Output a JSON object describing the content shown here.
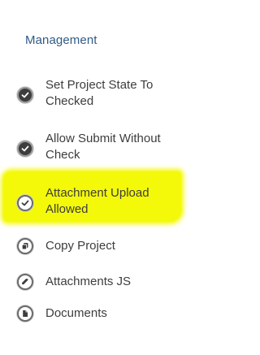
{
  "panel": {
    "section_title": "Management",
    "items": [
      {
        "label": "Set Project State To\nChecked",
        "icon": "checkmark-icon",
        "highlighted": false
      },
      {
        "label": "Allow Submit Without\nCheck",
        "icon": "checkmark-icon",
        "highlighted": false
      },
      {
        "label": "Attachment Upload\nAllowed",
        "icon": "checkmark-icon",
        "highlighted": true
      },
      {
        "label": "Copy Project",
        "icon": "copy-icon",
        "highlighted": false
      },
      {
        "label": "Attachments JS",
        "icon": "paperclip-icon",
        "highlighted": false
      },
      {
        "label": "Documents",
        "icon": "document-icon",
        "highlighted": false
      }
    ]
  },
  "colors": {
    "section_title": "#2f5b86",
    "text": "#3d3d3d",
    "highlight": "#f4f90a"
  }
}
